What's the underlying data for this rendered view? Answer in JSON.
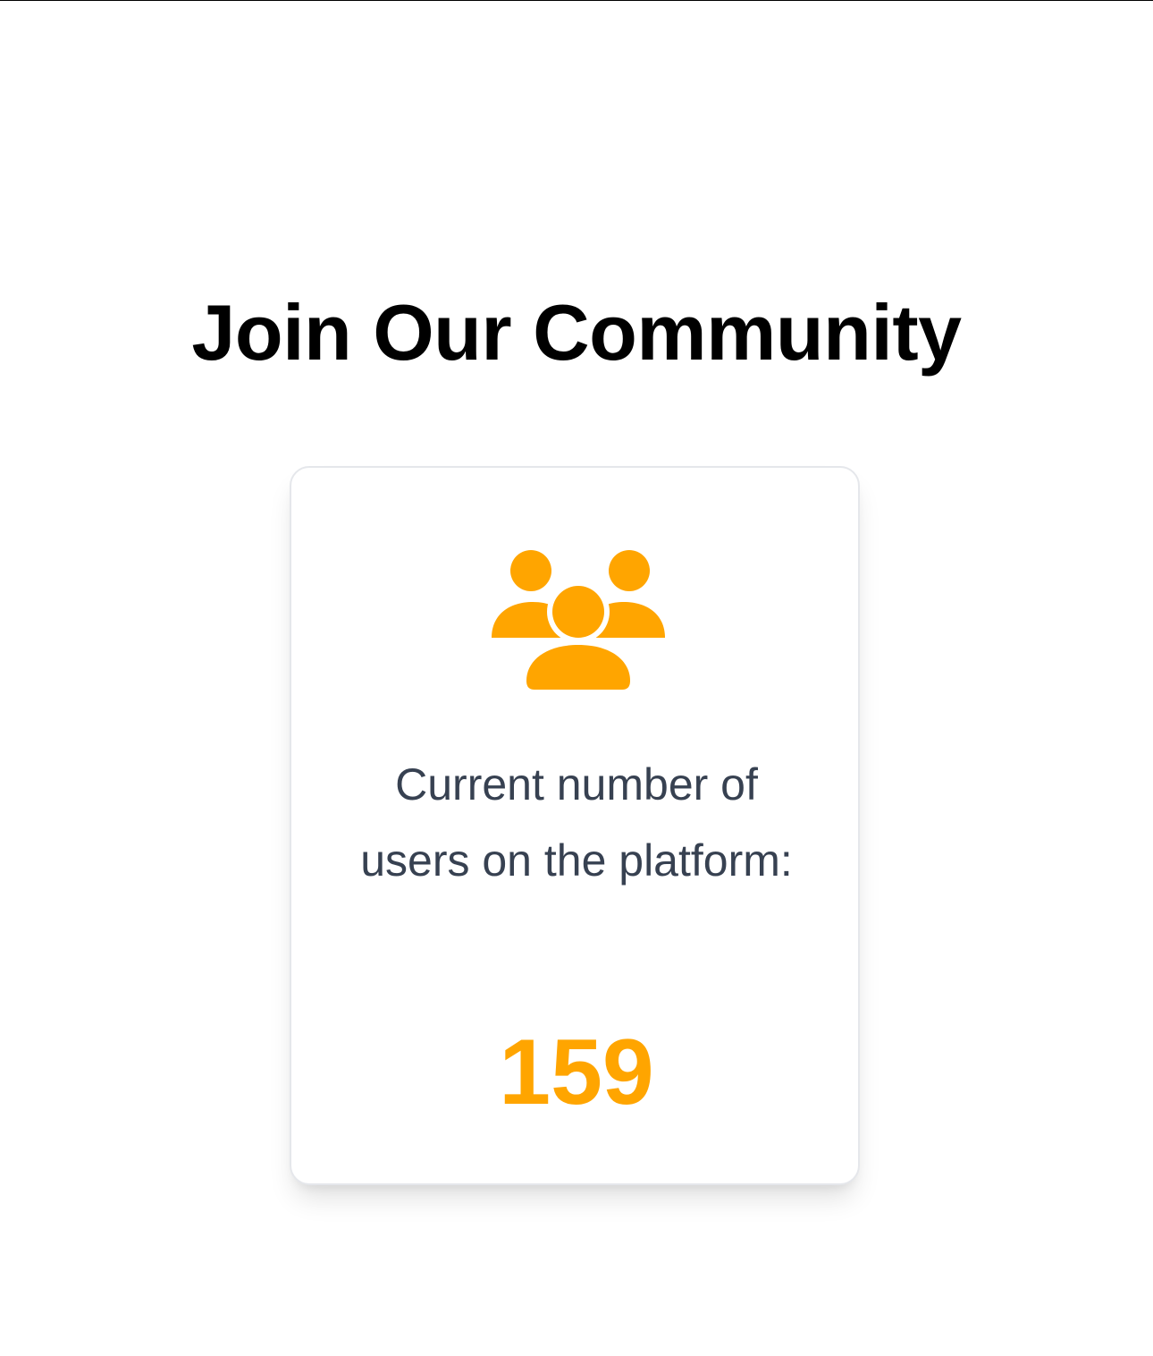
{
  "page": {
    "title": "Join Our Community"
  },
  "stats_card": {
    "icon": "users-group-icon",
    "label": "Current number of users on the platform:",
    "count": "159"
  },
  "colors": {
    "accent": "#FFA500",
    "label_text": "#374151",
    "title_text": "#000000",
    "card_border": "#E5E7EB"
  }
}
